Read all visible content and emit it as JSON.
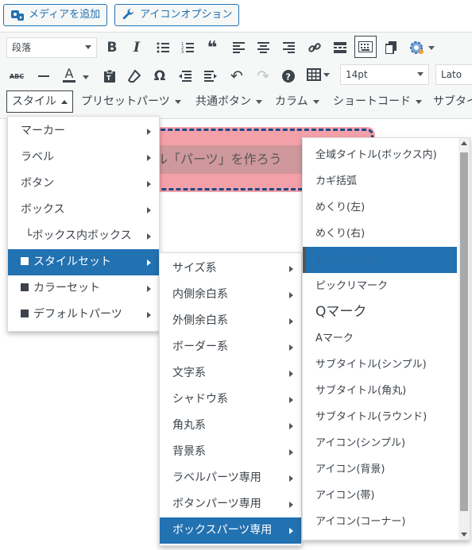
{
  "top_buttons": {
    "add_media": "メディアを追加",
    "icon_options": "アイコンオプション"
  },
  "toolbar": {
    "format_select": "段落",
    "font_size_select": "14pt",
    "font_family_select": "Lato",
    "menus": [
      "スタイル",
      "プリセットパーツ",
      "共通ボタン",
      "カラム",
      "ショートコード",
      "サブタイ"
    ]
  },
  "editor": {
    "box_title": "ル「パーツ」を作ろう"
  },
  "style_menu": {
    "items": [
      {
        "label": "マーカー",
        "has_sub": true
      },
      {
        "label": "ラベル",
        "has_sub": true
      },
      {
        "label": "ボタン",
        "has_sub": true
      },
      {
        "label": "ボックス",
        "has_sub": true
      },
      {
        "label": "└ボックス内ボックス",
        "has_sub": true
      },
      {
        "label": "スタイルセット",
        "has_sub": true,
        "square": true,
        "selected": true
      },
      {
        "label": "カラーセット",
        "has_sub": true,
        "square": true
      },
      {
        "label": "デフォルトパーツ",
        "has_sub": true,
        "square": true
      }
    ]
  },
  "styleset_menu": {
    "items": [
      "サイズ系",
      "内側余白系",
      "外側余白系",
      "ボーダー系",
      "文字系",
      "シャドウ系",
      "角丸系",
      "背景系",
      "ラベルパーツ専用",
      "ボタンパーツ専用",
      "ボックスパーツ専用"
    ],
    "selected_index": 10
  },
  "boxparts_menu": {
    "items": [
      "全域タイトル(ボックス内)",
      "カギ括弧",
      "めくり(左)",
      "めくり(右)",
      "ピックマーク",
      "ピックリマーク",
      "Qマーク",
      "Aマーク",
      "サブタイトル(シンプル)",
      "サブタイトル(角丸)",
      "サブタイトル(ラウンド)",
      "アイコン(シンプル)",
      "アイコン(背景)",
      "アイコン(帯)",
      "アイコン(コーナー)"
    ],
    "selected_index": 4
  },
  "colors": {
    "accent": "#2271b1",
    "box_fill": "#f4a0a8",
    "box_border": "#1e4a8a"
  }
}
